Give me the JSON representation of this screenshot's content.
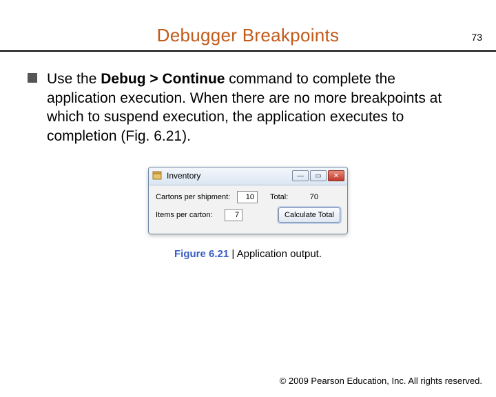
{
  "page_number": "73",
  "title": "Debugger Breakpoints",
  "body": {
    "pre": "Use the ",
    "bold": "Debug > Continue",
    "post": " command to complete the application execution. When there are no more breakpoints at which to suspend execution, the application executes to completion (Fig. 6.21)."
  },
  "app": {
    "window_title": "Inventory",
    "row1_label": "Cartons per shipment:",
    "row1_value": "10",
    "row1_out_label": "Total:",
    "row1_out_value": "70",
    "row2_label": "Items per carton:",
    "row2_value": "7",
    "button_label": "Calculate Total"
  },
  "caption": {
    "fig": "Figure 6.21",
    "sep": " | ",
    "text": "Application output."
  },
  "footer": "© 2009 Pearson Education, Inc. All rights reserved."
}
